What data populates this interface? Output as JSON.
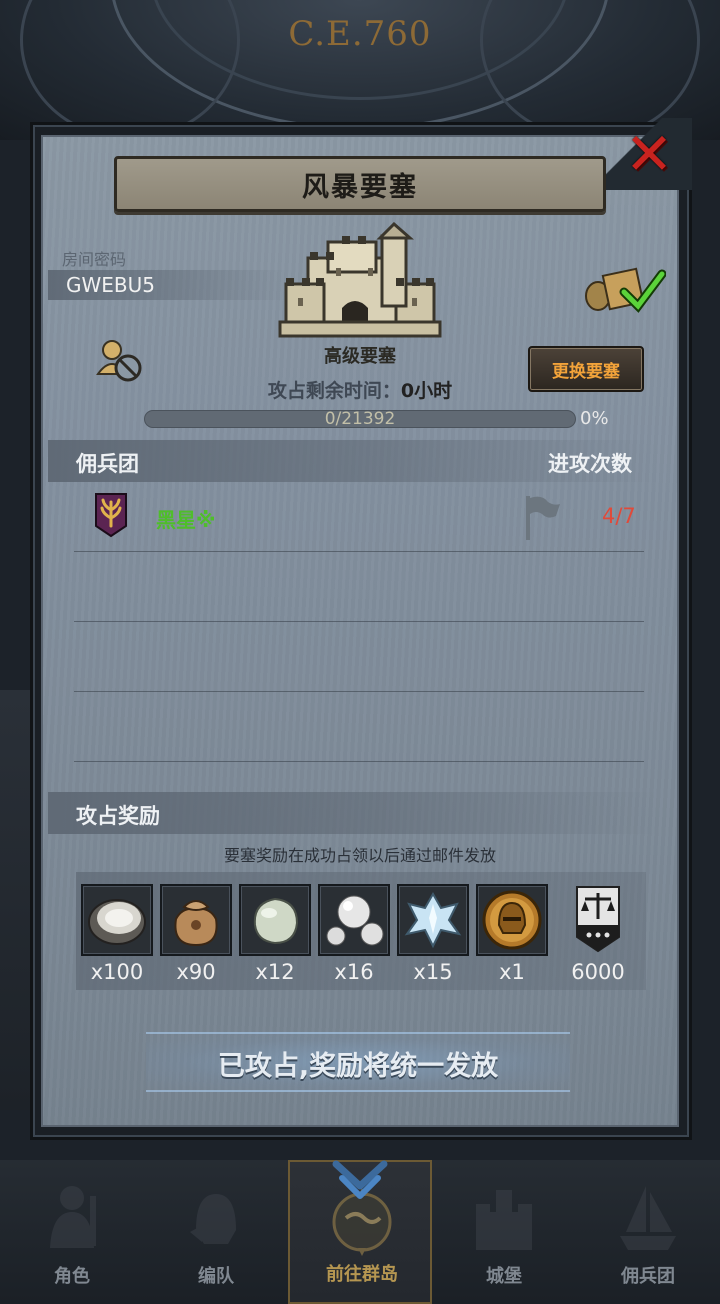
{
  "background": {
    "era": "C.E.760"
  },
  "dialog": {
    "title": "风暴要塞",
    "close_icon": "close-icon",
    "room_code_label": "房间密码",
    "room_code": "GWEBU5",
    "fortress_type": "高级要塞",
    "change_button": "更换要塞",
    "occupy_time_label": "攻占剩余时间：",
    "occupy_time_value": "0小时",
    "progress": {
      "text": "0/21392",
      "percent_label": "0%",
      "fraction": 0
    },
    "mercenary": {
      "header": "佣兵团",
      "attacks_header": "进攻次数",
      "rows": [
        {
          "name": "黑星※",
          "attacks": "4/7",
          "emblem_icon": "wheat-banner-icon",
          "flag_icon": "flag-icon"
        }
      ]
    },
    "rewards": {
      "header": "攻占奖励",
      "note": "要塞奖励在成功占领以后通过邮件发放",
      "items": [
        {
          "icon": "oyster-icon",
          "qty": "x100"
        },
        {
          "icon": "sack-icon",
          "qty": "x90"
        },
        {
          "icon": "stone-icon",
          "qty": "x12"
        },
        {
          "icon": "pearl-icon",
          "qty": "x16"
        },
        {
          "icon": "crystal-icon",
          "qty": "x15"
        },
        {
          "icon": "helmet-coin-icon",
          "qty": "x1"
        },
        {
          "icon": "scales-banner-icon",
          "qty": "6000"
        }
      ]
    },
    "status": "已攻占,奖励将统一发放"
  },
  "bottom_nav": {
    "items": [
      {
        "label": "角色",
        "icon": "knight-icon"
      },
      {
        "label": "编队",
        "icon": "helmet-icon"
      },
      {
        "label": "前往群岛",
        "icon": "compass-icon"
      },
      {
        "label": "城堡",
        "icon": "castle-icon"
      },
      {
        "label": "佣兵团",
        "icon": "ship-icon"
      }
    ],
    "active_index": 2
  },
  "colors": {
    "panel": "#8491a0",
    "accent_orange": "#f2a33a",
    "guild_green": "#4fbe2a",
    "attack_red": "#e04a3a",
    "close_red": "#c8231f"
  }
}
